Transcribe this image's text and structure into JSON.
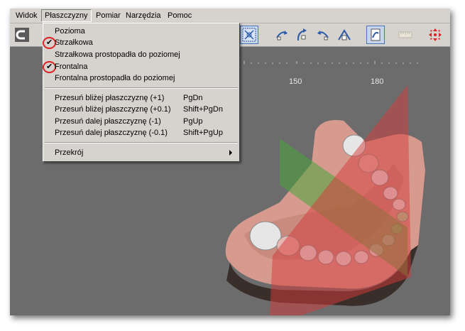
{
  "menubar": {
    "items": [
      {
        "label": "Widok"
      },
      {
        "label": "Płaszczyzny"
      },
      {
        "label": "Pomiar"
      },
      {
        "label": "Narzędzia"
      },
      {
        "label": "Pomoc"
      }
    ]
  },
  "dropdown": {
    "group1": [
      {
        "label": "Pozioma",
        "checked": false
      },
      {
        "label": "Strzałkowa",
        "checked": true
      },
      {
        "label": "Strzałkowa prostopadła do poziomej",
        "checked": false
      },
      {
        "label": "Frontalna",
        "checked": true
      },
      {
        "label": "Frontalna prostopadła do poziomej",
        "checked": false
      }
    ],
    "group2": [
      {
        "label": "Przesuń bliżej płaszczyznę (+1)",
        "shortcut": "PgDn"
      },
      {
        "label": "Przesuń bliżej płaszczyznę (+0.1)",
        "shortcut": "Shift+PgDn"
      },
      {
        "label": "Przesuń dalej płaszczyznę (-1)",
        "shortcut": "PgUp"
      },
      {
        "label": "Przesuń dalej płaszczyznę (-0.1)",
        "shortcut": "Shift+PgUp"
      }
    ],
    "group3": [
      {
        "label": "Przekrój"
      }
    ]
  },
  "ruler": {
    "labels": [
      "150",
      "180"
    ]
  },
  "colors": {
    "menu_bg": "#d6d3ce",
    "viewport_bg": "#6c6c6c",
    "highlight_circle": "#e02020",
    "gum": "#d69b8e",
    "sagittal_plane": "#4aa53a",
    "frontal_plane": "#d63a3a"
  }
}
